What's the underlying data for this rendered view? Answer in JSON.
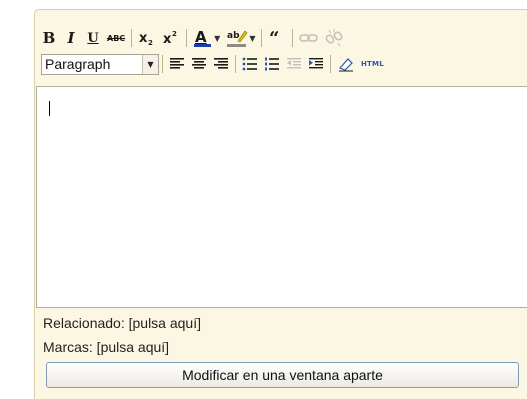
{
  "toolbar": {
    "bold_label": "B",
    "italic_label": "I",
    "underline_label": "U",
    "strike_label": "ABC",
    "text_color_label": "A",
    "format_select": {
      "value": "Paragraph"
    },
    "html_label": "HTML"
  },
  "icons": [
    "bold-icon",
    "italic-icon",
    "underline-icon",
    "strikethrough-icon",
    "subscript-icon",
    "superscript-icon",
    "text-color-icon",
    "highlight-icon",
    "blockquote-icon",
    "link-icon",
    "unlink-icon",
    "align-left-icon",
    "align-center-icon",
    "align-right-icon",
    "bullet-list-icon",
    "numbered-list-icon",
    "outdent-icon",
    "indent-icon",
    "eraser-icon",
    "html-icon"
  ],
  "colors": {
    "text_color_bar": "#1b3fa6",
    "highlight_bar": "#8d8a86",
    "panel_bg": "#fbf7e3",
    "button_border": "#7f9db9"
  },
  "editor": {
    "content": ""
  },
  "meta": {
    "related": "Relacionado: [pulsa aquí]",
    "tags": "Marcas: [pulsa aquí]"
  },
  "open_window_button": "Modificar en una ventana aparte"
}
